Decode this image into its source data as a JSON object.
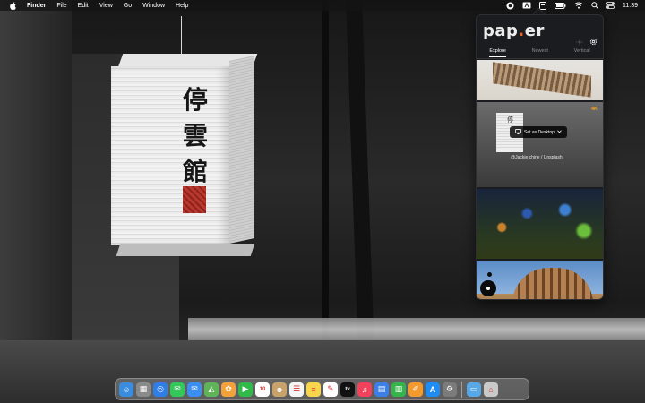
{
  "menubar": {
    "app_name": "Finder",
    "items": [
      "File",
      "Edit",
      "View",
      "Go",
      "Window",
      "Help"
    ],
    "clock": "11:39"
  },
  "wallpaper": {
    "lantern_characters": [
      "停",
      "雲",
      "館"
    ]
  },
  "paper_app": {
    "logo_main": "pap",
    "logo_dot": ".",
    "logo_end": "er",
    "tabs": [
      "Explore",
      "Newest",
      "Vertical"
    ],
    "active_tab": "Explore",
    "thumbnails": [
      {
        "name": "architecture-stairs"
      },
      {
        "name": "paper-lantern",
        "resolution_badge": "4K",
        "set_label": "Set as Desktop",
        "credit": "@Jackie chine / Unsplash"
      },
      {
        "name": "bokeh-lights"
      },
      {
        "name": "colosseum"
      }
    ],
    "accent_color": "#e8622c"
  },
  "dock": {
    "apps": [
      {
        "name": "finder",
        "color": "#3a8dde",
        "glyph": "☺"
      },
      {
        "name": "launchpad",
        "color": "#8a8a8a",
        "glyph": "▦"
      },
      {
        "name": "safari",
        "color": "#2f7ee8",
        "glyph": "◎"
      },
      {
        "name": "messages",
        "color": "#34c759",
        "glyph": "✉"
      },
      {
        "name": "mail",
        "color": "#3b8ff0",
        "glyph": "✉"
      },
      {
        "name": "maps",
        "color": "#5fb45a",
        "glyph": "◭"
      },
      {
        "name": "photos",
        "color": "#f2a23a",
        "glyph": "✿"
      },
      {
        "name": "facetime",
        "color": "#31b94a",
        "glyph": "▶"
      },
      {
        "name": "calendar",
        "color": "#ffffff",
        "glyph": "10"
      },
      {
        "name": "contacts",
        "color": "#c8a26b",
        "glyph": "☻"
      },
      {
        "name": "reminders",
        "color": "#f5f5f5",
        "glyph": "☰"
      },
      {
        "name": "notes",
        "color": "#f7d54c",
        "glyph": "≡"
      },
      {
        "name": "freeform",
        "color": "#ffffff",
        "glyph": "✎"
      },
      {
        "name": "tv",
        "color": "#111111",
        "glyph": "tv"
      },
      {
        "name": "music",
        "color": "#f2415a",
        "glyph": "♫"
      },
      {
        "name": "keynote",
        "color": "#3c7fe6",
        "glyph": "▤"
      },
      {
        "name": "numbers",
        "color": "#35b44c",
        "glyph": "▥"
      },
      {
        "name": "pages",
        "color": "#f29a2e",
        "glyph": "✐"
      },
      {
        "name": "app-store",
        "color": "#1f8cf2",
        "glyph": "A"
      },
      {
        "name": "system-settings",
        "color": "#7b7b7b",
        "glyph": "⚙"
      }
    ],
    "extras": [
      {
        "name": "downloads-folder",
        "color": "#56a8e8",
        "glyph": "▭"
      },
      {
        "name": "trash",
        "color": "#c9c9c9",
        "glyph": "⌂"
      }
    ]
  }
}
